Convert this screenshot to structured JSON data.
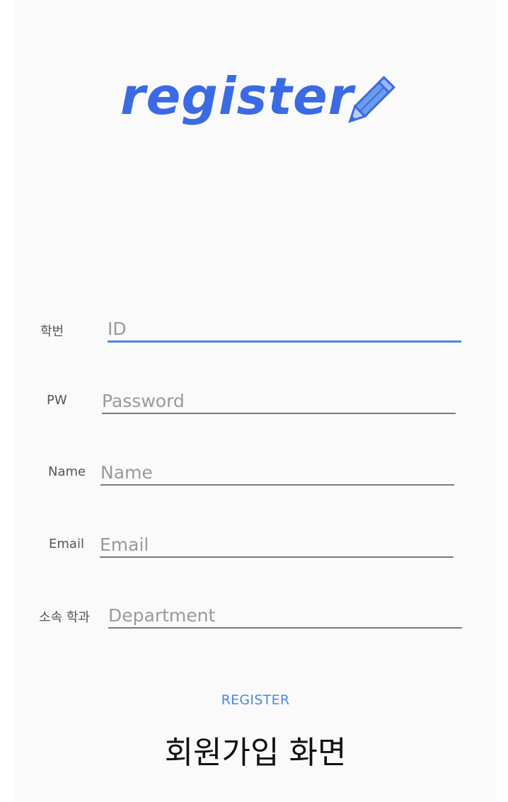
{
  "logo": {
    "text": "register",
    "color": "#3a6be3"
  },
  "form": {
    "fields": [
      {
        "label": "학번",
        "placeholder": "ID",
        "value": "",
        "focused": true
      },
      {
        "label": "PW",
        "placeholder": "Password",
        "value": ""
      },
      {
        "label": "Name",
        "placeholder": "Name",
        "value": ""
      },
      {
        "label": "Email",
        "placeholder": "Email",
        "value": ""
      },
      {
        "label": "소속 학과",
        "placeholder": "Department",
        "value": ""
      }
    ],
    "register_label": "REGISTER"
  },
  "caption": "회원가입 화면",
  "colors": {
    "accent": "#4a86e8",
    "background": "#fafafa"
  }
}
